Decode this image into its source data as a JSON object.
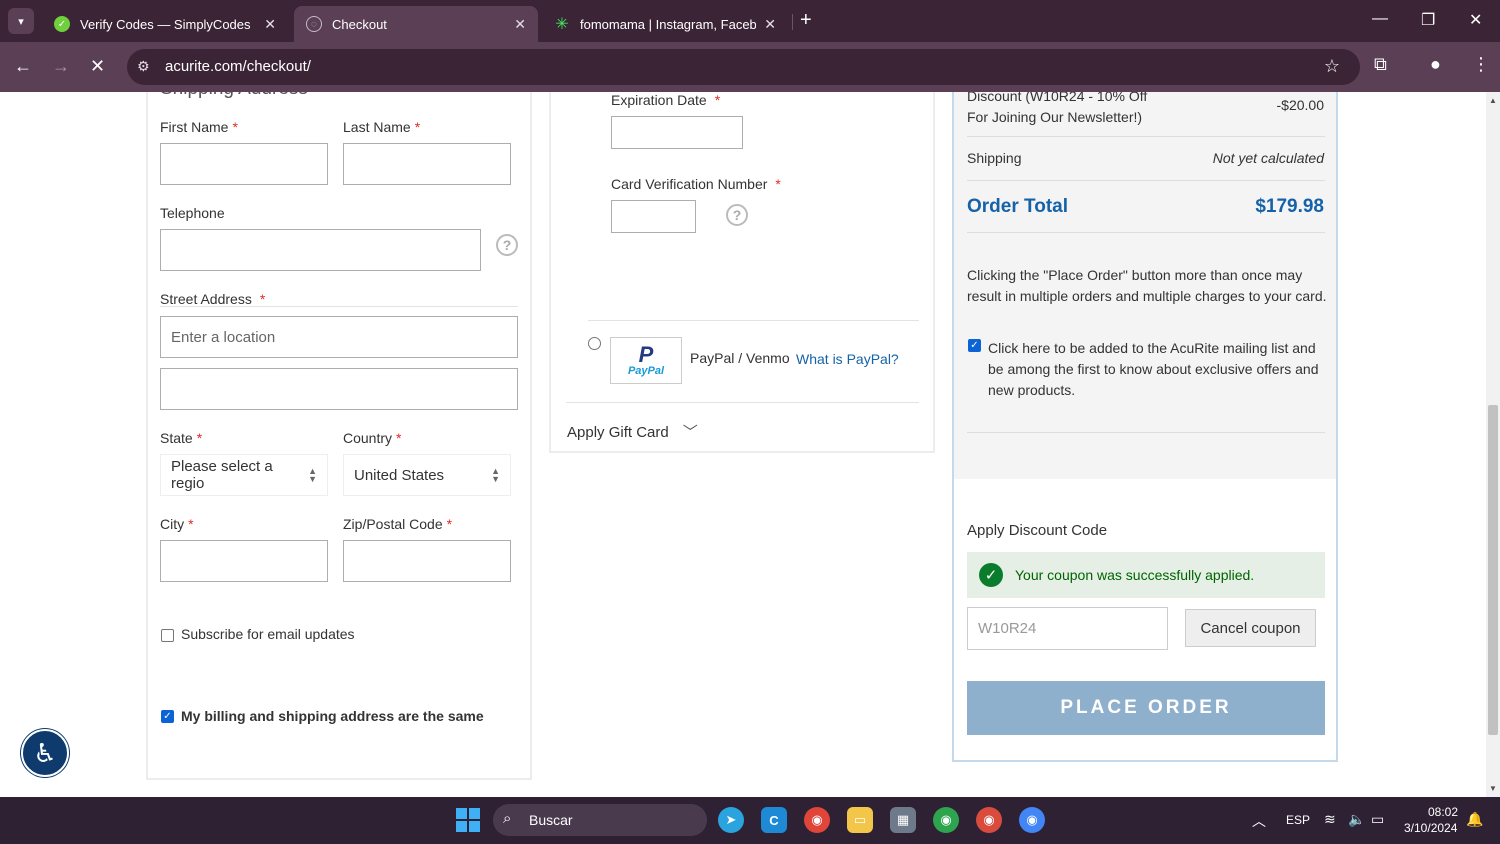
{
  "browser": {
    "tabs": [
      {
        "title": "Verify Codes — SimplyCodes",
        "icon": "simplycodes-icon"
      },
      {
        "title": "Checkout",
        "icon": "loading-icon"
      },
      {
        "title": "fomomama | Instagram, Facebook",
        "icon": "linktree-icon"
      }
    ],
    "url": "acurite.com/checkout/"
  },
  "shipping": {
    "section_title_partial": "Shipping Address",
    "first_name_label": "First Name",
    "last_name_label": "Last Name",
    "telephone_label": "Telephone",
    "street_label": "Street Address",
    "street_placeholder": "Enter a location",
    "state_label": "State",
    "state_value": "Please select a regio",
    "country_label": "Country",
    "country_value": "United States",
    "city_label": "City",
    "zip_label": "Zip/Postal Code",
    "subscribe_label": "Subscribe for email updates",
    "same_address_label": "My billing and shipping address are the same",
    "required_mark": "*"
  },
  "payment": {
    "expiration_label": "Expiration Date",
    "cvv_label": "Card Verification Number",
    "paypal_label": "PayPal / Venmo",
    "paypal_link": "What is PayPal?",
    "paypal_logo_text": "PayPal",
    "gift_card_label": "Apply Gift Card"
  },
  "summary": {
    "discount_label_line1": "Discount (W10R24 - 10% Off",
    "discount_label_line2": "For Joining Our Newsletter!)",
    "discount_value": "-$20.00",
    "shipping_label": "Shipping",
    "shipping_value": "Not yet calculated",
    "order_total_label": "Order Total",
    "order_total_value": "$179.98",
    "notice": "Clicking the \"Place Order\" button more than once may result in multiple orders and multiple charges to your card.",
    "mailing_label": "Click here to be added to the AcuRite mailing list and be among the first to know about exclusive offers and new products.",
    "discount_code_title": "Apply Discount Code",
    "coupon_success": "Your coupon was successfully applied.",
    "coupon_value": "W10R24",
    "cancel_coupon": "Cancel coupon",
    "place_order": "PLACE ORDER",
    "accent_color": "#1662a8"
  },
  "taskbar": {
    "search_placeholder": "Buscar",
    "language": "ESP",
    "time": "08:02",
    "date": "3/10/2024"
  }
}
